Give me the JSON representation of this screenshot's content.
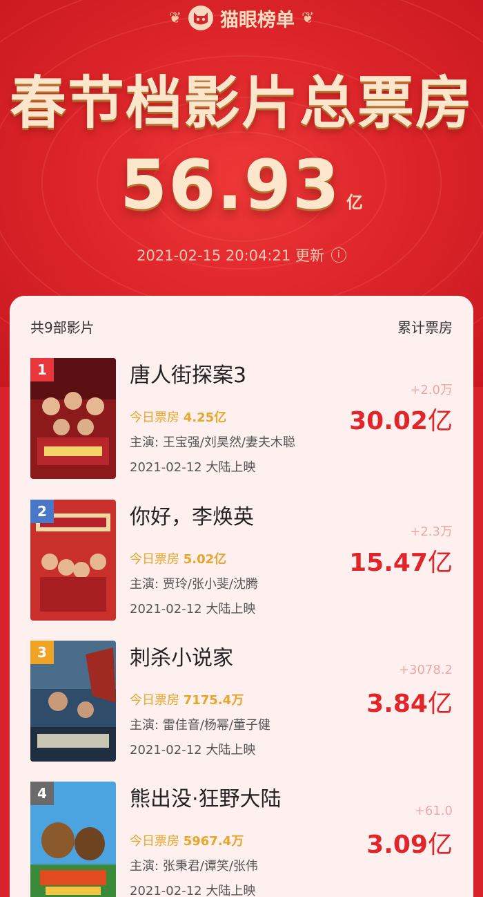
{
  "header": {
    "brand": "猫眼榜单",
    "title": "春节档影片总票房",
    "total_value": "56.93",
    "total_unit": "亿",
    "updated": "2021-02-15 20:04:21 更新",
    "icons": [
      "laurel-left-icon",
      "cat-logo-icon",
      "laurel-right-icon",
      "info-icon"
    ]
  },
  "list": {
    "count_label": "共9部影片",
    "cumulative_label": "累计票房",
    "rank_colors": {
      "1": "#e8383d",
      "2": "#4a78c9",
      "3": "#f0a325",
      "4": "#6a6a6a"
    },
    "movies": [
      {
        "rank": "1",
        "title": "唐人街探案3",
        "today_label": "今日票房",
        "today_value": "4.25亿",
        "cast": "主演: 王宝强/刘昊然/妻夫木聪",
        "release": "2021-02-12 大陆上映",
        "delta": "+2.0万",
        "cumulative": "30.02",
        "unit": "亿"
      },
      {
        "rank": "2",
        "title": "你好，李焕英",
        "today_label": "今日票房",
        "today_value": "5.02亿",
        "cast": "主演: 贾玲/张小斐/沈腾",
        "release": "2021-02-12 大陆上映",
        "delta": "+2.3万",
        "cumulative": "15.47",
        "unit": "亿"
      },
      {
        "rank": "3",
        "title": "刺杀小说家",
        "today_label": "今日票房",
        "today_value": "7175.4万",
        "cast": "主演: 雷佳音/杨幂/董子健",
        "release": "2021-02-12 大陆上映",
        "delta": "+3078.2",
        "cumulative": "3.84",
        "unit": "亿"
      },
      {
        "rank": "4",
        "title": "熊出没·狂野大陆",
        "today_label": "今日票房",
        "today_value": "5967.4万",
        "cast": "主演: 张秉君/谭笑/张伟",
        "release": "2021-02-12 大陆上映",
        "delta": "+61.0",
        "cumulative": "3.09",
        "unit": "亿"
      }
    ]
  }
}
